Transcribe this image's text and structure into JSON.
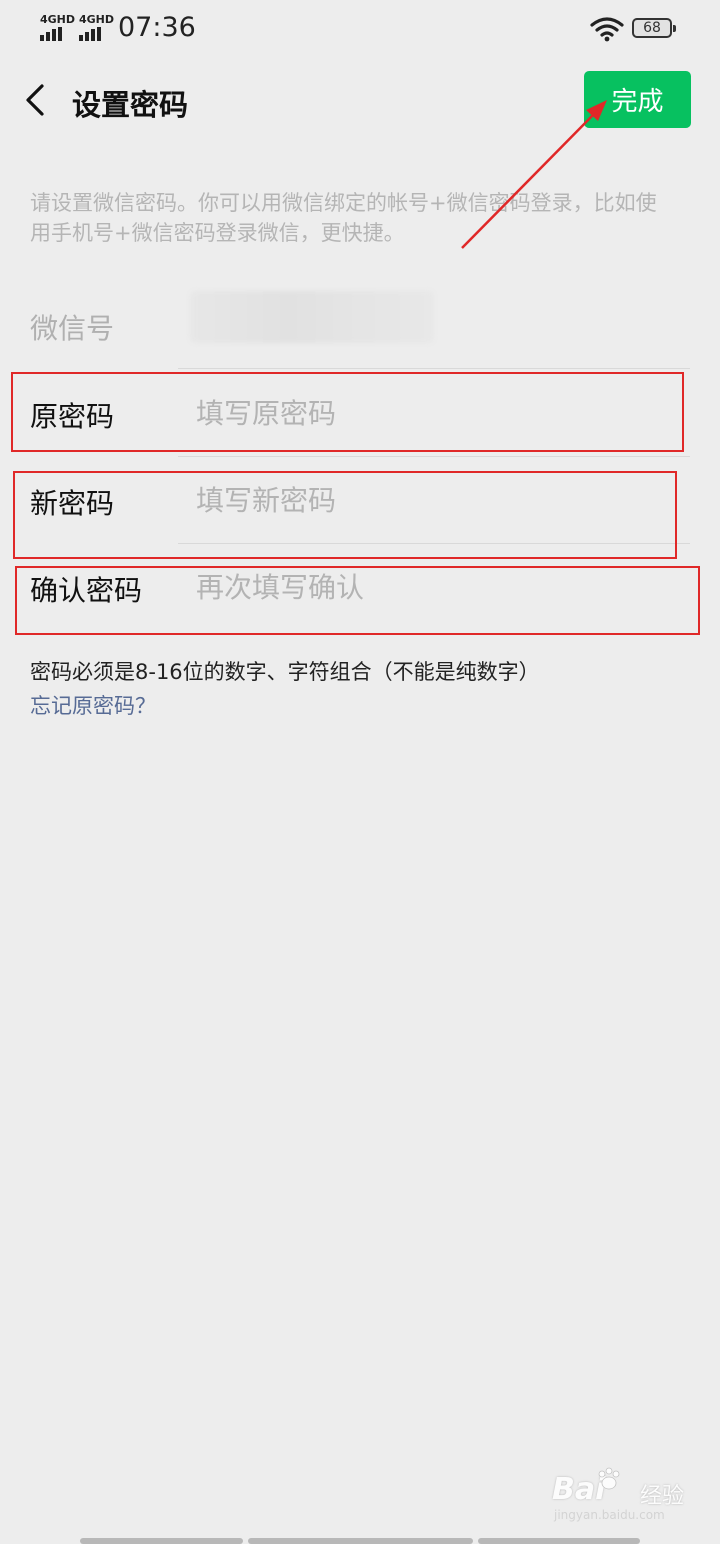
{
  "status_bar": {
    "network_1": "4GHD",
    "network_2": "4GHD",
    "time": "07:36",
    "battery": "68"
  },
  "nav": {
    "back_icon": "chevron-left-icon",
    "title": "设置密码",
    "done_label": "完成"
  },
  "description": "请设置微信密码。你可以用微信绑定的帐号+微信密码登录，比如使用手机号+微信密码登录微信，更快捷。",
  "form": {
    "wechat_id_label": "微信号",
    "old_password_label": "原密码",
    "old_password_placeholder": "填写原密码",
    "new_password_label": "新密码",
    "new_password_placeholder": "填写新密码",
    "confirm_password_label": "确认密码",
    "confirm_password_placeholder": "再次填写确认"
  },
  "hint": "密码必须是8-16位的数字、字符组合（不能是纯数字）",
  "forgot_link": "忘记原密码？",
  "annotation_color": "#e02828",
  "accent_color": "#07c160",
  "watermark": {
    "brand": "Bai",
    "sub": "经验",
    "url": "jingyan.baidu.com"
  }
}
